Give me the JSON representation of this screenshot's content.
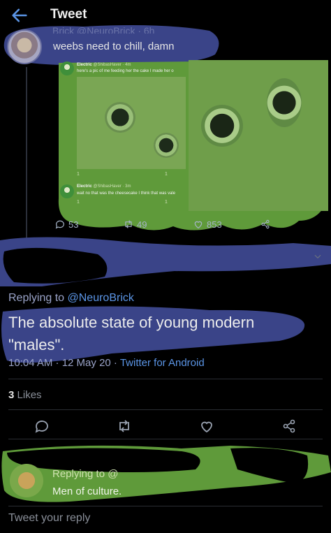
{
  "header": {
    "title": "Tweet"
  },
  "quoted_tweet": {
    "handle_partial": "Brick @NeuroBrick · 6h",
    "text": "weebs need to chill, damn",
    "embedded": [
      {
        "name": "Electric",
        "handle": "@ShibasHaver · 4m",
        "text": "here's a pic of me feeding her the cake I made her o",
        "stats": [
          "1",
          "",
          "1"
        ]
      },
      {
        "name": "Electric",
        "handle": "@ShibasHaver · 3m",
        "text": "wait no that was the cheesecake I think that was vale",
        "stats": [
          "1",
          "",
          "1"
        ]
      }
    ],
    "stats": {
      "replies": "53",
      "retweets": "49",
      "likes": "853"
    }
  },
  "main_tweet": {
    "replying_prefix": "Replying to",
    "replying_to": "@NeuroBrick",
    "text": "The absolute state of young modern \"males\".",
    "timestamp": "10:04 AM · 12 May 20 · ",
    "app": "Twitter for Android",
    "likes_count": "3",
    "likes_label": "Likes"
  },
  "reply_tweet": {
    "replying": "Replying to @",
    "text": "Men of culture."
  },
  "compose": {
    "placeholder": "Tweet your reply"
  },
  "colors": {
    "background": "#000000",
    "link": "#5b95e6",
    "scribble_blue": "#3a4488",
    "scribble_green": "#5f9a3a"
  },
  "icons": [
    "back-arrow-icon",
    "reply-icon",
    "retweet-icon",
    "like-icon",
    "share-icon",
    "chevron-down-icon"
  ]
}
